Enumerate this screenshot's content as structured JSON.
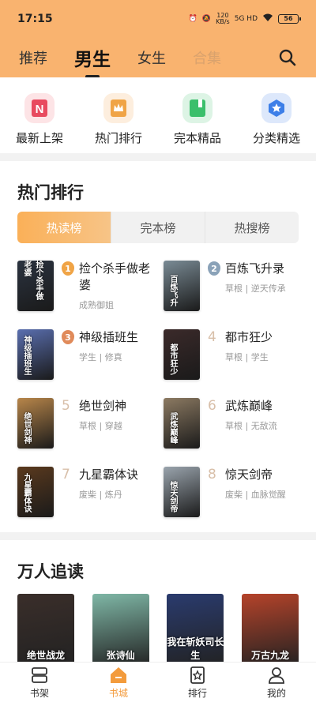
{
  "status": {
    "time": "17:15",
    "net_speed": "120",
    "net_unit": "KB/s",
    "net_type": "5G HD",
    "battery": "56"
  },
  "topnav": {
    "tabs": [
      {
        "label": "推荐"
      },
      {
        "label": "男生"
      },
      {
        "label": "女生"
      },
      {
        "label": "合集"
      }
    ]
  },
  "categories": [
    {
      "label": "最新上架",
      "icon": "new-icon",
      "color": "#e84a5f"
    },
    {
      "label": "热门排行",
      "icon": "crown-icon",
      "color": "#f0a446"
    },
    {
      "label": "完本精品",
      "icon": "book-icon",
      "color": "#3bbf6b"
    },
    {
      "label": "分类精选",
      "icon": "star-icon",
      "color": "#3d7fe8"
    }
  ],
  "ranking": {
    "title": "热门排行",
    "tabs": [
      "热读榜",
      "完本榜",
      "热搜榜"
    ],
    "items": [
      {
        "rank": "1",
        "title": "捡个杀手做老婆",
        "meta": "成熟御姐",
        "cover_text": "捡个杀手做老婆",
        "cover_color": "#2b3340"
      },
      {
        "rank": "2",
        "title": "百炼飞升录",
        "meta": "草根 | 逆天传承",
        "cover_text": "百炼飞升",
        "cover_color": "#7a8b95"
      },
      {
        "rank": "3",
        "title": "神级插班生",
        "meta": "学生 | 修真",
        "cover_text": "神级插班生",
        "cover_color": "#5a6fb0"
      },
      {
        "rank": "4",
        "title": "都市狂少",
        "meta": "草根 | 学生",
        "cover_text": "都市狂少",
        "cover_color": "#3b2a2a"
      },
      {
        "rank": "5",
        "title": "绝世剑神",
        "meta": "草根 | 穿越",
        "cover_text": "绝世剑神",
        "cover_color": "#b8864a"
      },
      {
        "rank": "6",
        "title": "武炼巅峰",
        "meta": "草根 | 无敌流",
        "cover_text": "武炼巅峰",
        "cover_color": "#8c7a62"
      },
      {
        "rank": "7",
        "title": "九星霸体诀",
        "meta": "废柴 | 炼丹",
        "cover_text": "九星霸体诀",
        "cover_color": "#5b3a1e"
      },
      {
        "rank": "8",
        "title": "惊天剑帝",
        "meta": "废柴 | 血脉觉醒",
        "cover_text": "惊天剑帝",
        "cover_color": "#9aa4ad"
      }
    ]
  },
  "popular": {
    "title": "万人追读",
    "books": [
      {
        "cover_text": "绝世战龙",
        "color": "#3a2e2a"
      },
      {
        "cover_text": "张诗仙",
        "color": "#7fb7a6"
      },
      {
        "cover_text": "我在斩妖司长生",
        "color": "#2a3b6e"
      },
      {
        "cover_text": "万古九龙",
        "color": "#b5432a"
      }
    ]
  },
  "bottomnav": [
    {
      "label": "书架",
      "icon": "bookshelf-icon"
    },
    {
      "label": "书城",
      "icon": "bookstore-icon"
    },
    {
      "label": "排行",
      "icon": "ranking-icon"
    },
    {
      "label": "我的",
      "icon": "profile-icon"
    }
  ],
  "colors": {
    "accent": "#f9b36f",
    "active_tab": "#f39b3c",
    "rank1": "#f0a446",
    "rank2": "#8aa2b8",
    "rank3": "#e08a5a"
  }
}
